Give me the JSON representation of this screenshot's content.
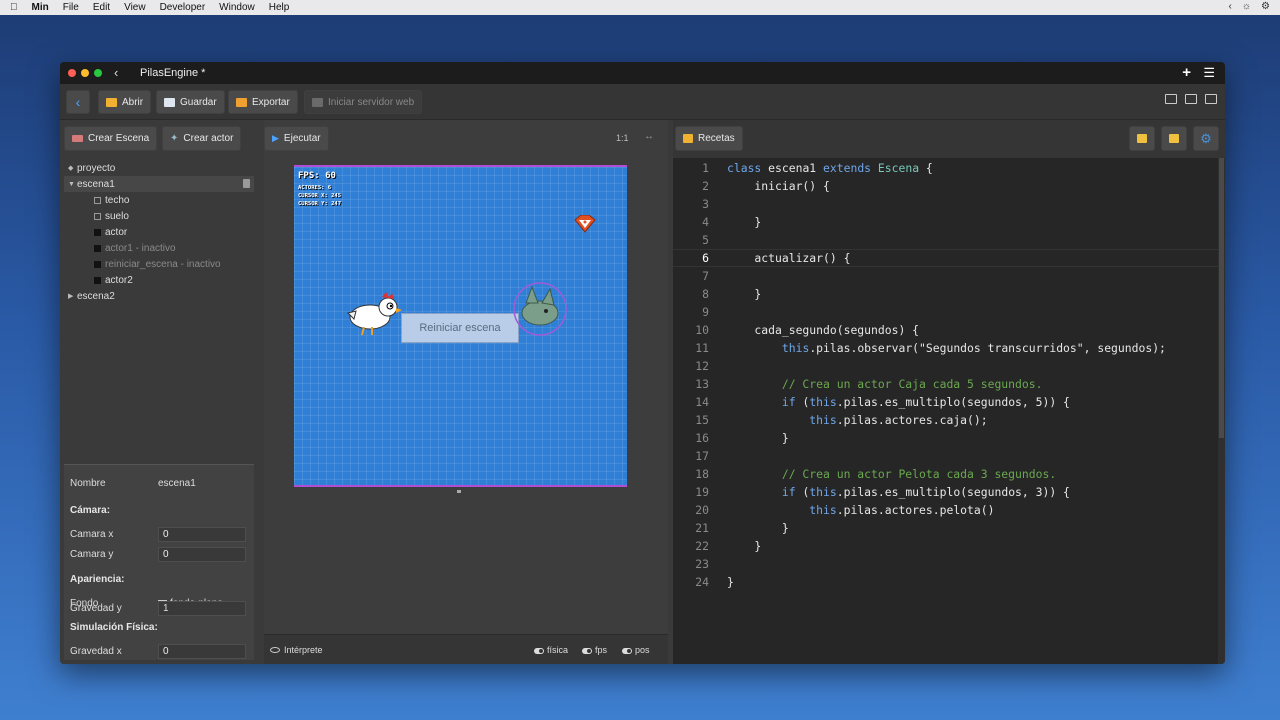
{
  "menubar": {
    "app": "Min",
    "items": [
      "File",
      "Edit",
      "View",
      "Developer",
      "Window",
      "Help"
    ]
  },
  "window": {
    "title": "PilasEngine *"
  },
  "toolbar": {
    "open_label": "Abrir",
    "save_label": "Guardar",
    "export_label": "Exportar",
    "server_label": "Iniciar servidor web"
  },
  "left": {
    "create_scene_label": "Crear Escena",
    "create_actor_label": "Crear actor",
    "tree": [
      {
        "label": "proyecto",
        "level": 0,
        "kind": "diamond"
      },
      {
        "label": "escena1",
        "level": 0,
        "kind": "open"
      },
      {
        "label": "techo",
        "level": 1,
        "kind": "empty"
      },
      {
        "label": "suelo",
        "level": 1,
        "kind": "empty"
      },
      {
        "label": "actor",
        "level": 1,
        "kind": "filled"
      },
      {
        "label": "actor1 - inactivo",
        "level": 1,
        "kind": "filled",
        "inactive": true
      },
      {
        "label": "reiniciar_escena - inactivo",
        "level": 1,
        "kind": "filled",
        "inactive": true
      },
      {
        "label": "actor2",
        "level": 1,
        "kind": "filled"
      },
      {
        "label": "escena2",
        "level": 0,
        "kind": "closed"
      }
    ],
    "props": {
      "name_label": "Nombre",
      "name_value": "escena1",
      "camera_head": "Cámara:",
      "camera_x_label": "Camara x",
      "camera_x_value": "0",
      "camera_y_label": "Camara y",
      "camera_y_value": "0",
      "appearance_head": "Apariencia:",
      "background_label": "Fondo",
      "background_value": "fondo-plano",
      "physics_head": "Simulación Física:",
      "gravity_x_label": "Gravedad x",
      "gravity_x_value": "0",
      "gravity_y_label": "Gravedad y",
      "gravity_y_value": "1"
    }
  },
  "center": {
    "run_label": "Ejecutar",
    "zoom_label": "1:1",
    "fps_text": "FPS: 60",
    "actors_text": "ACTORES: 6",
    "cursor_x_text": "CURSOR X: 245",
    "cursor_y_text": "CURSOR Y: 247",
    "restart_label": "Reiniciar escena",
    "interpreter_label": "Intérprete",
    "toggle_physics": "física",
    "toggle_fps": "fps",
    "toggle_pos": "pos"
  },
  "right": {
    "recipes_label": "Recetas",
    "current_line": 6,
    "code": [
      [
        [
          "kw",
          "class"
        ],
        [
          "t",
          " escena1 "
        ],
        [
          "kw",
          "extends"
        ],
        [
          "t",
          " "
        ],
        [
          "cls",
          "Escena"
        ],
        [
          "t",
          " {"
        ]
      ],
      [
        [
          "t",
          "    iniciar() {"
        ]
      ],
      [
        [
          "t",
          ""
        ]
      ],
      [
        [
          "t",
          "    }"
        ]
      ],
      [
        [
          "t",
          ""
        ]
      ],
      [
        [
          "t",
          "    actualizar() {"
        ]
      ],
      [
        [
          "t",
          ""
        ]
      ],
      [
        [
          "t",
          "    }"
        ]
      ],
      [
        [
          "t",
          ""
        ]
      ],
      [
        [
          "t",
          "    cada_segundo(segundos) {"
        ]
      ],
      [
        [
          "t",
          "        "
        ],
        [
          "kw",
          "this"
        ],
        [
          "t",
          ".pilas.observar(\"Segundos transcurridos\", segundos);"
        ]
      ],
      [
        [
          "t",
          ""
        ]
      ],
      [
        [
          "cm",
          "        // Crea un actor Caja cada 5 segundos."
        ]
      ],
      [
        [
          "t",
          "        "
        ],
        [
          "kw",
          "if"
        ],
        [
          "t",
          " ("
        ],
        [
          "kw",
          "this"
        ],
        [
          "t",
          ".pilas.es_multiplo(segundos, 5)) {"
        ]
      ],
      [
        [
          "t",
          "            "
        ],
        [
          "kw",
          "this"
        ],
        [
          "t",
          ".pilas.actores.caja();"
        ]
      ],
      [
        [
          "t",
          "        }"
        ]
      ],
      [
        [
          "t",
          ""
        ]
      ],
      [
        [
          "cm",
          "        // Crea un actor Pelota cada 3 segundos."
        ]
      ],
      [
        [
          "t",
          "        "
        ],
        [
          "kw",
          "if"
        ],
        [
          "t",
          " ("
        ],
        [
          "kw",
          "this"
        ],
        [
          "t",
          ".pilas.es_multiplo(segundos, 3)) {"
        ]
      ],
      [
        [
          "t",
          "            "
        ],
        [
          "kw",
          "this"
        ],
        [
          "t",
          ".pilas.actores.pelota()"
        ]
      ],
      [
        [
          "t",
          "        }"
        ]
      ],
      [
        [
          "t",
          "    }"
        ]
      ],
      [
        [
          "t",
          ""
        ]
      ],
      [
        [
          "t",
          "}"
        ]
      ]
    ]
  },
  "colors": {
    "canvas_bg": "#2f7fd6",
    "keyword": "#6fa6e9",
    "comment": "#6aa84f"
  }
}
